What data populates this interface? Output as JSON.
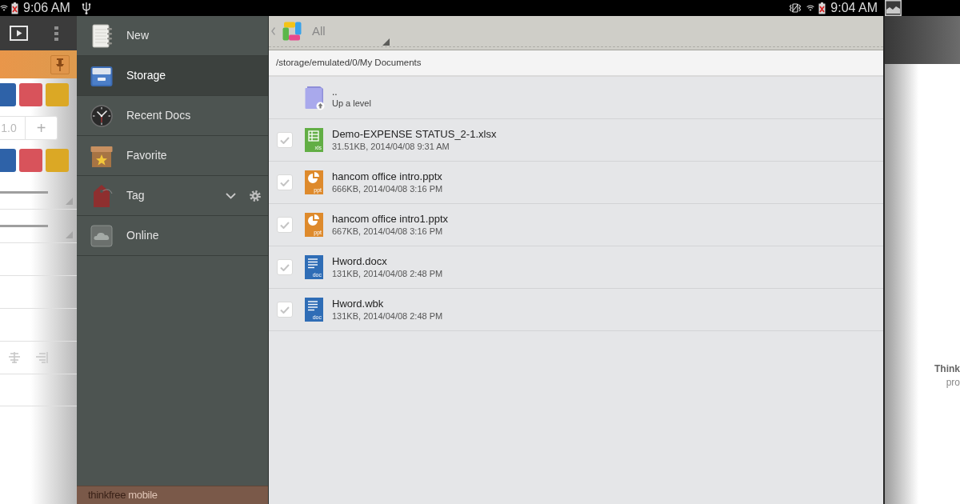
{
  "status_bar": {
    "left_time": "9:06 AM",
    "right_time": "9:04 AM"
  },
  "format_panel": {
    "swatch_rows": [
      [
        {
          "color": "#2e62a8"
        },
        {
          "color": "#d8535b"
        },
        {
          "color": "#dba825"
        }
      ],
      [
        {
          "color": "#2e62a8"
        },
        {
          "color": "#d8535b"
        },
        {
          "color": "#dba825"
        }
      ]
    ],
    "stepper": {
      "value": "1.0",
      "plus": "+"
    }
  },
  "drawer": {
    "items": [
      {
        "kind": "new",
        "label": "New",
        "selected": false
      },
      {
        "kind": "storage",
        "label": "Storage",
        "selected": true
      },
      {
        "kind": "recent",
        "label": "Recent Docs",
        "selected": false
      },
      {
        "kind": "favorite",
        "label": "Favorite",
        "selected": false
      },
      {
        "kind": "tag",
        "label": "Tag",
        "selected": false
      },
      {
        "kind": "online",
        "label": "Online",
        "selected": false
      }
    ],
    "brand": {
      "name": "thinkfree",
      "suffix": "mobile"
    }
  },
  "file_browser": {
    "filter": "All",
    "path": "/storage/emulated/0/My Documents",
    "parent": {
      "name": "..",
      "caption": "Up a level"
    },
    "files": [
      {
        "kind": "spreadsheet",
        "badge": "xls",
        "name": "Demo-EXPENSE STATUS_2-1.xlsx",
        "details": "31.51KB, 2014/04/08 9:31 AM",
        "checked": false
      },
      {
        "kind": "presentation",
        "badge": "ppt",
        "name": "hancom office intro.pptx",
        "details": "666KB, 2014/04/08 3:16 PM",
        "checked": false
      },
      {
        "kind": "presentation",
        "badge": "ppt",
        "name": "hancom office intro1.pptx",
        "details": "667KB, 2014/04/08 3:16 PM",
        "checked": false
      },
      {
        "kind": "document",
        "badge": "doc",
        "name": "Hword.docx",
        "details": "131KB, 2014/04/08 2:48 PM",
        "checked": false
      },
      {
        "kind": "document",
        "badge": "doc",
        "name": "Hword.wbk",
        "details": "131KB, 2014/04/08 2:48 PM",
        "checked": false
      }
    ]
  },
  "background_window": {
    "lines": [
      "Think",
      "pro"
    ]
  }
}
